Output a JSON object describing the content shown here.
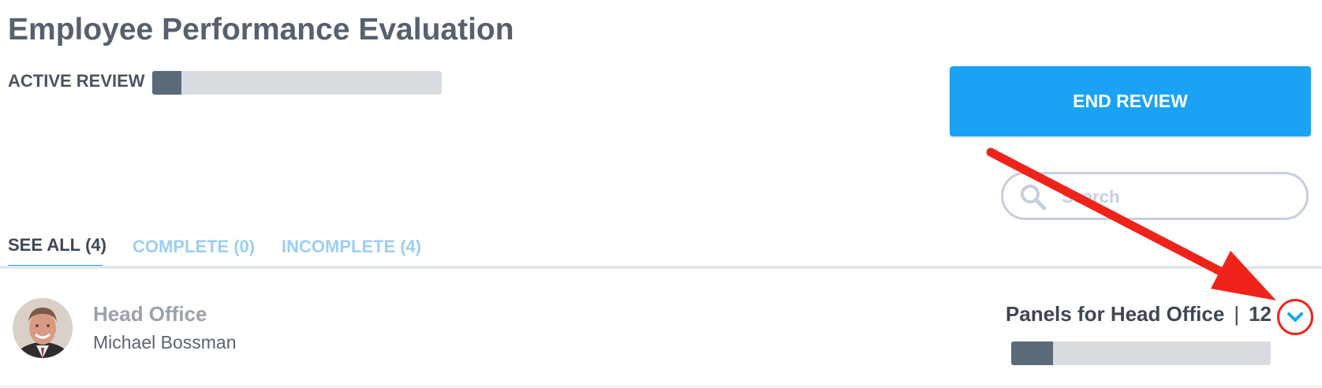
{
  "header": {
    "title": "Employee Performance Evaluation",
    "active_review_label": "ACTIVE REVIEW",
    "active_review_progress": 0.1
  },
  "actions": {
    "end_review_label": "END REVIEW"
  },
  "search": {
    "placeholder": "Search",
    "value": ""
  },
  "tabs": [
    {
      "label": "SEE ALL",
      "count": "(4)",
      "active": true
    },
    {
      "label": "COMPLETE",
      "count": "(0)",
      "active": false
    },
    {
      "label": "INCOMPLETE",
      "count": "(4)",
      "active": false
    }
  ],
  "rows": [
    {
      "office": "Head Office",
      "manager": "Michael Bossman",
      "panels_label": "Panels for Head Office",
      "separator": "|",
      "panel_count": "12",
      "progress": 0.16,
      "icon": "chevron-down-icon"
    }
  ],
  "colors": {
    "accent": "#1aa3f5",
    "progress_fill": "#5b6a79",
    "progress_track": "#d8dbdf",
    "annotation_red": "#f0231a"
  }
}
